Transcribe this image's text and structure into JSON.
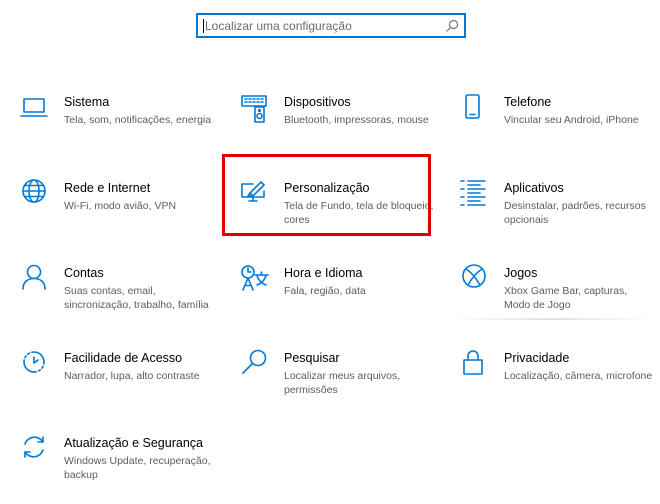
{
  "search": {
    "placeholder": "Localizar uma configuração"
  },
  "colors": {
    "accent": "#0078d7",
    "highlight": "#e00000"
  },
  "tiles": [
    {
      "title": "Sistema",
      "desc": "Tela, som, notificações, energia",
      "icon": "laptop-icon"
    },
    {
      "title": "Dispositivos",
      "desc": "Bluetooth, impressoras, mouse",
      "icon": "keyboard-speaker-icon"
    },
    {
      "title": "Telefone",
      "desc": "Vincular seu Android, iPhone",
      "icon": "phone-icon"
    },
    {
      "title": "Rede e Internet",
      "desc": "Wi-Fi, modo avião, VPN",
      "icon": "globe-icon"
    },
    {
      "title": "Personalização",
      "desc": "Tela de Fundo, tela de bloqueio, cores",
      "icon": "paint-brush-monitor-icon"
    },
    {
      "title": "Aplicativos",
      "desc": "Desinstalar, padrões, recursos opcionais",
      "icon": "apps-list-icon"
    },
    {
      "title": "Contas",
      "desc": "Suas contas, email, sincronização, trabalho, família",
      "icon": "person-icon"
    },
    {
      "title": "Hora e Idioma",
      "desc": "Fala, região, data",
      "icon": "time-language-icon"
    },
    {
      "title": "Jogos",
      "desc": "Xbox Game Bar, capturas, Modo de Jogo",
      "icon": "xbox-icon"
    },
    {
      "title": "Facilidade de Acesso",
      "desc": "Narrador, lupa, alto contraste",
      "icon": "ease-of-access-icon"
    },
    {
      "title": "Pesquisar",
      "desc": "Localizar meus arquivos, permissões",
      "icon": "search-magnifier-icon"
    },
    {
      "title": "Privacidade",
      "desc": "Localização, câmera, microfone",
      "icon": "lock-icon"
    },
    {
      "title": "Atualização e Segurança",
      "desc": "Windows Update, recuperação, backup",
      "icon": "sync-arrows-icon"
    }
  ]
}
